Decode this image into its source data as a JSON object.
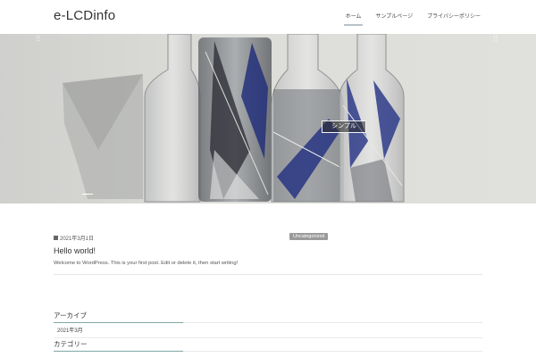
{
  "site": {
    "title": "e-LCDinfo"
  },
  "nav": {
    "items": [
      "ホーム",
      "サンプルページ",
      "プライバシーポリシー"
    ]
  },
  "hero": {
    "caption": "シンプル"
  },
  "post": {
    "date": "2021年3月1日",
    "category": "Uncategorized",
    "title": "Hello world!",
    "excerpt": "Welcome to WordPress. This is your first post. Edit or delete it, then start writing!"
  },
  "widgets": {
    "archive_title": "アーカイブ",
    "archive_items": [
      "2021年3月"
    ],
    "category_title": "カテゴリー"
  }
}
